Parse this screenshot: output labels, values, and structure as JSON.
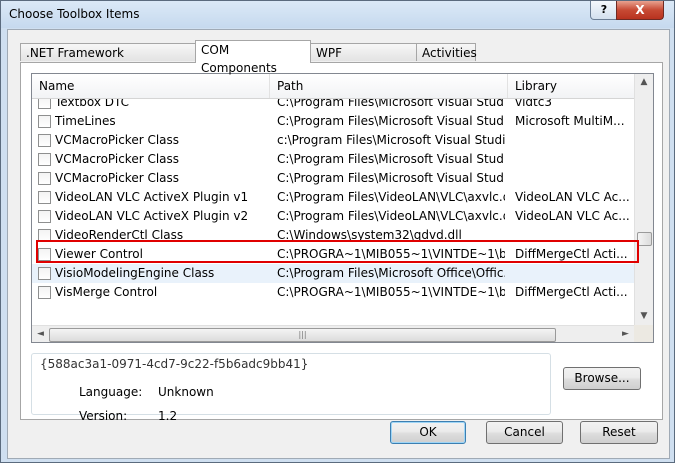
{
  "window": {
    "title": "Choose Toolbox Items",
    "help_glyph": "?",
    "close_glyph": "X"
  },
  "tabs": [
    {
      "label": ".NET Framework Components",
      "active": false
    },
    {
      "label": "COM Components",
      "active": true
    },
    {
      "label": "WPF Components",
      "active": false
    },
    {
      "label": "Activities",
      "active": false
    }
  ],
  "list": {
    "columns": {
      "name": "Name",
      "path": "Path",
      "library": "Library"
    },
    "rows": [
      {
        "name": "Textbox DTC",
        "path": "C:\\Program Files\\Microsoft Visual Studio...",
        "library": "vidtc3",
        "checked": false
      },
      {
        "name": "TimeLines",
        "path": "C:\\Program Files\\Microsoft Visual Studio...",
        "library": "Microsoft MultiM...",
        "checked": false
      },
      {
        "name": "VCMacroPicker Class",
        "path": "c:\\Program Files\\Microsoft Visual Studio...",
        "library": "",
        "checked": false
      },
      {
        "name": "VCMacroPicker Class",
        "path": "C:\\Program Files\\Microsoft Visual Studio...",
        "library": "",
        "checked": false
      },
      {
        "name": "VCMacroPicker Class",
        "path": "C:\\Program Files\\Microsoft Visual Studio...",
        "library": "",
        "checked": false
      },
      {
        "name": "VideoLAN VLC ActiveX Plugin v1",
        "path": "C:\\Program Files\\VideoLAN\\VLC\\axvlc.dll",
        "library": "VideoLAN VLC Ac...",
        "checked": false
      },
      {
        "name": "VideoLAN VLC ActiveX Plugin v2",
        "path": "C:\\Program Files\\VideoLAN\\VLC\\axvlc.dll",
        "library": "VideoLAN VLC Ac...",
        "checked": false
      },
      {
        "name": "VideoRenderCtl Class",
        "path": "C:\\Windows\\system32\\qdvd.dll",
        "library": "",
        "checked": false
      },
      {
        "name": "Viewer Control",
        "path": "C:\\PROGRA~1\\MIB055~1\\VINTDE~1\\bin...",
        "library": "DiffMergeCtl Acti...",
        "checked": false
      },
      {
        "name": "VisioModelingEngine Class",
        "path": "C:\\Program Files\\Microsoft Office\\Offic...",
        "library": "",
        "checked": false
      },
      {
        "name": "VisMerge Control",
        "path": "C:\\PROGRA~1\\MIB055~1\\VINTDE~1\\bin...",
        "library": "DiffMergeCtl Acti...",
        "checked": false
      }
    ],
    "hover_row": 9,
    "outlined_row": 6,
    "scroll_up": "▲",
    "scroll_down": "▼",
    "scroll_left": "◄",
    "scroll_right": "►",
    "grip": "|||"
  },
  "info": {
    "guid": "{588ac3a1-0971-4cd7-9c22-f5b6adc9bb41}",
    "language_label": "Language:",
    "language_value": "Unknown",
    "version_label": "Version:",
    "version_value": "1.2"
  },
  "buttons": {
    "browse": "Browse...",
    "ok": "OK",
    "cancel": "Cancel",
    "reset": "Reset"
  },
  "colors": {
    "highlight_outline": "#e00000",
    "hover_row": "#e9f2fb",
    "close_button": "#c74a34"
  }
}
